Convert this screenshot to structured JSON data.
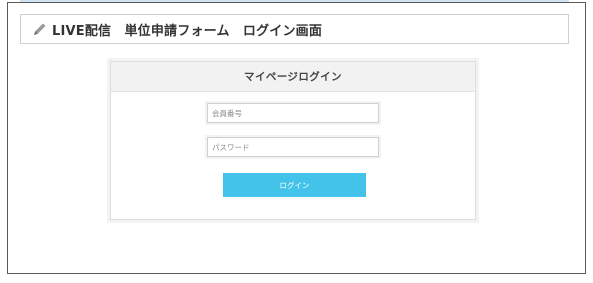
{
  "header": {
    "title": "LIVE配信　単位申請フォーム　ログイン画面",
    "icon": "pencil-icon"
  },
  "login": {
    "card_title": "マイページログイン",
    "member_number_placeholder": "会員番号",
    "password_placeholder": "パスワード",
    "button_label": "ログイン"
  },
  "colors": {
    "button": "#44c3ea",
    "frame_border": "#5a5a5a",
    "top_strip": "#cfe3f3"
  }
}
